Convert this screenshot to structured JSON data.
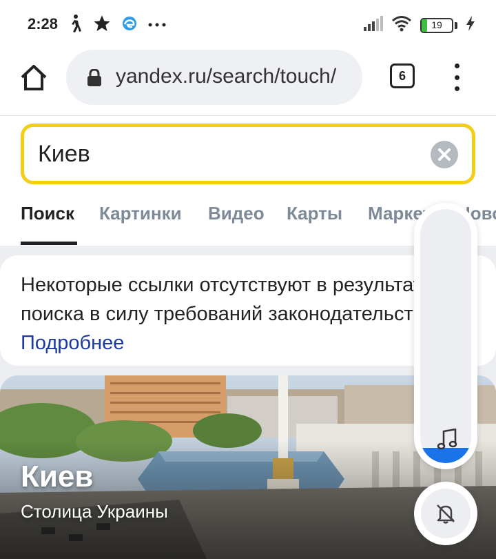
{
  "status_bar": {
    "time": "2:28",
    "battery_level": "19",
    "icons_left": [
      "walking-icon",
      "star-icon",
      "edge-icon",
      "more-dots-icon"
    ],
    "icons_right": [
      "signal-icon",
      "wifi-icon",
      "battery-icon",
      "charging-icon"
    ]
  },
  "browser": {
    "url": "yandex.ru/search/touch/",
    "tab_count": "6"
  },
  "search": {
    "value": "Киев"
  },
  "tabs": [
    {
      "label": "Поиск",
      "active": true
    },
    {
      "label": "Картинки"
    },
    {
      "label": "Видео"
    },
    {
      "label": "Карты"
    },
    {
      "label": "Маркет"
    },
    {
      "label": "Новости"
    }
  ],
  "notice": {
    "text": "Некоторые ссылки отсутствуют в результатах поиска в силу требований законодательства РФ. ",
    "link": "Подробнее"
  },
  "entity": {
    "title": "Киев",
    "subtitle": "Столица Украины"
  },
  "volume": {
    "level": 0.06
  },
  "colors": {
    "search_border": "#f4ce16",
    "link": "#1c3ba0",
    "volume_fill": "#1a73e8"
  }
}
